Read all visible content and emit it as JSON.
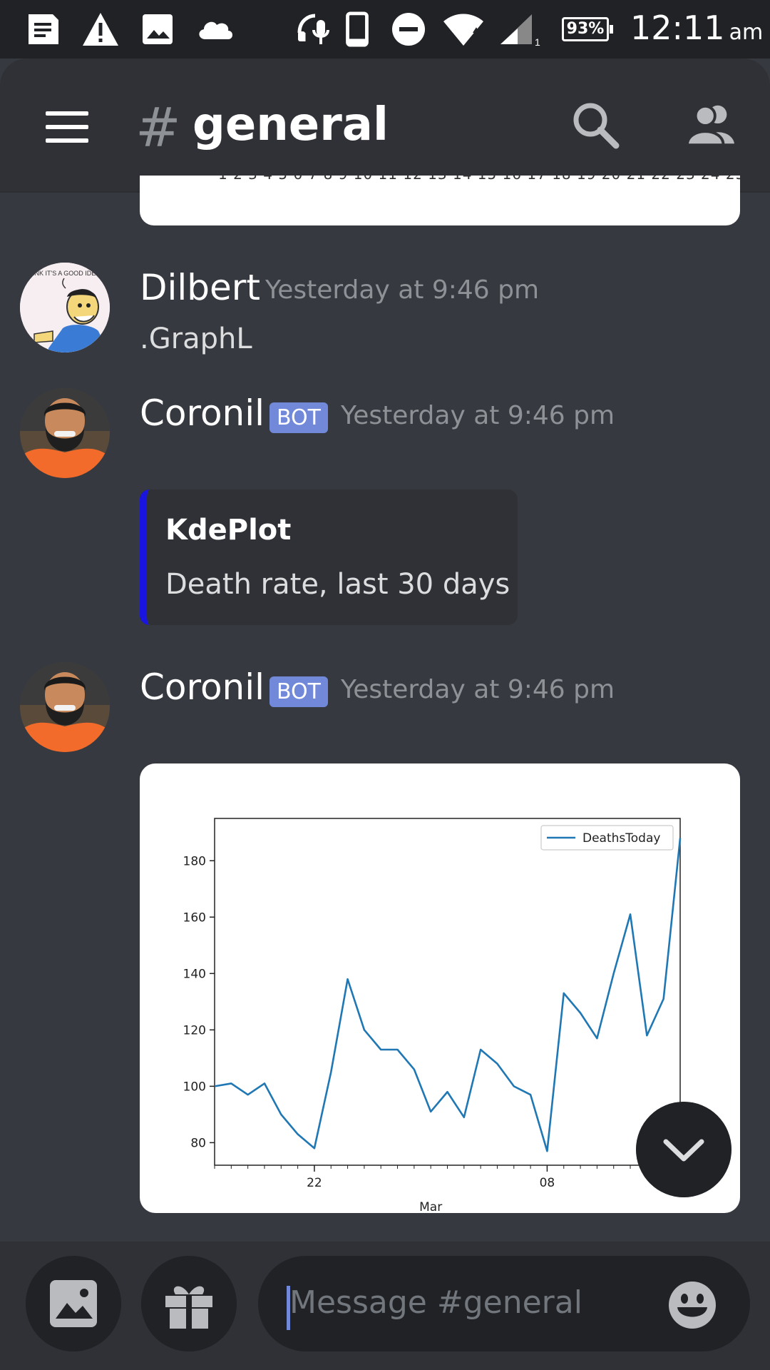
{
  "status_bar": {
    "battery": "93%",
    "time": "12:11",
    "ampm": "am"
  },
  "header": {
    "hash": "#",
    "channel": "general"
  },
  "messages": [
    {
      "author": "Dilbert",
      "timestamp": "Yesterday at 9:46 pm",
      "text": ".GraphL",
      "avatar_caption": "I THINK IT'S A GOOD IDEA."
    },
    {
      "author": "Coronil",
      "bot_tag": "BOT",
      "timestamp": "Yesterday at 9:46 pm",
      "embed": {
        "title": "KdePlot",
        "description": "Death rate, last 30 days",
        "accent_color": "#1a14e0"
      }
    },
    {
      "author": "Coronil",
      "bot_tag": "BOT",
      "timestamp": "Yesterday at 9:46 pm"
    }
  ],
  "chart_data": {
    "type": "line",
    "series": [
      {
        "name": "DeathsToday",
        "color": "#1f77b4",
        "values": [
          100,
          101,
          97,
          101,
          90,
          83,
          78,
          105,
          138,
          120,
          113,
          113,
          106,
          91,
          98,
          89,
          113,
          108,
          100,
          97,
          77,
          133,
          126,
          117,
          140,
          161,
          118,
          131,
          188
        ]
      }
    ],
    "x_tick_labels": [
      "22",
      "08"
    ],
    "x_sublabel": "Mar",
    "y_ticks": [
      "80",
      "100",
      "120",
      "140",
      "160",
      "180"
    ],
    "ylim": [
      72,
      195
    ],
    "legend_position": "top-right"
  },
  "input": {
    "placeholder": "Message #general"
  },
  "colors": {
    "background": "#36393f",
    "header": "#2f3136",
    "bot_tag": "#7289da"
  }
}
